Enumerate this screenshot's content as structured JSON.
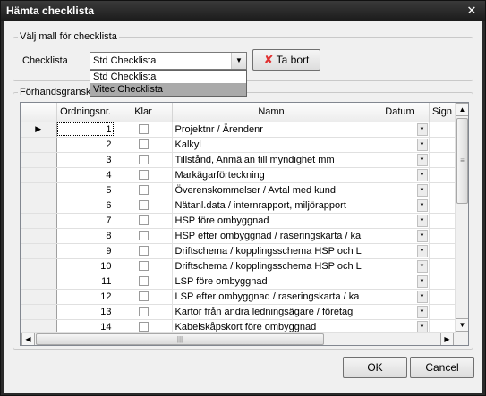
{
  "window": {
    "title": "Hämta checklista",
    "close_icon": "close-icon"
  },
  "template_group": {
    "label": "Välj mall för checklista",
    "field_label": "Checklista",
    "combo_value": "Std Checklista",
    "options": [
      "Std Checklista",
      "Vitec Checklista"
    ],
    "highlighted_option": "Vitec Checklista",
    "delete_button": "Ta bort"
  },
  "preview_group": {
    "label": "Förhandsgranskning"
  },
  "grid": {
    "columns": [
      "Ordningsnr.",
      "Klar",
      "Namn",
      "Datum",
      "Sign"
    ],
    "rows": [
      {
        "nr": "1",
        "name": "Projektnr / Ärendenr"
      },
      {
        "nr": "2",
        "name": "Kalkyl"
      },
      {
        "nr": "3",
        "name": "Tillstånd, Anmälan till myndighet mm"
      },
      {
        "nr": "4",
        "name": "Markägarförteckning"
      },
      {
        "nr": "5",
        "name": "Överenskommelser / Avtal med kund"
      },
      {
        "nr": "6",
        "name": "Nätanl.data / internrapport, miljörapport"
      },
      {
        "nr": "7",
        "name": "HSP före ombyggnad"
      },
      {
        "nr": "8",
        "name": "HSP efter ombyggnad / raseringskarta / ka"
      },
      {
        "nr": "9",
        "name": "Driftschema / kopplingsschema HSP och L"
      },
      {
        "nr": "10",
        "name": "Driftschema / kopplingsschema HSP och L"
      },
      {
        "nr": "11",
        "name": "LSP före ombyggnad"
      },
      {
        "nr": "12",
        "name": "LSP efter ombyggnad / raseringskarta / ka"
      },
      {
        "nr": "13",
        "name": "Kartor från andra ledningsägare / företag"
      },
      {
        "nr": "14",
        "name": "Kabelskåpskort före ombyggnad"
      }
    ]
  },
  "buttons": {
    "ok": "OK",
    "cancel": "Cancel"
  },
  "colors": {
    "titlebar": "#2a2a2a",
    "selected_option": "#aaaaaa",
    "delete_icon": "#e03030"
  }
}
